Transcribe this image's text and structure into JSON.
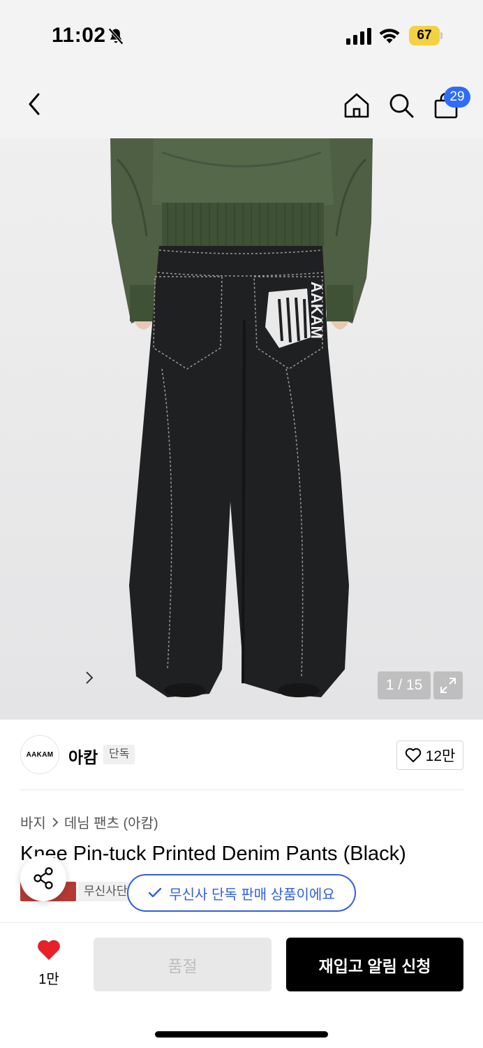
{
  "status_bar": {
    "time": "11:02",
    "battery": "67"
  },
  "header": {
    "cart_count": "29"
  },
  "gallery": {
    "counter": "1 / 15"
  },
  "brand": {
    "logo_text": "AAKAM",
    "name": "아캄",
    "tag": "단독",
    "likes": "12만"
  },
  "product": {
    "breadcrumb": [
      "바지",
      "데님 팬츠 (아캄)"
    ],
    "title": "Knee Pin-tuck Printed Denim Pants (Black)",
    "tag_red": "상",
    "tag_grey": "무신사단독"
  },
  "toast": {
    "text": "무신사 단독 판매 상품이에요"
  },
  "bottom_bar": {
    "like_count": "1만",
    "soldout_label": "품절",
    "restock_label": "재입고 알림 신청"
  },
  "colors": {
    "accent": "#2f5fe0",
    "badge": "#2f6df6",
    "like_red": "#e8202a",
    "tag_red": "#b53a33"
  },
  "icons": [
    "bell-slash-icon",
    "signal-icon",
    "wifi-icon",
    "back-icon",
    "home-icon",
    "search-icon",
    "bag-icon",
    "expand-icon",
    "heart-outline-icon",
    "chevron-right-icon",
    "share-icon",
    "check-icon",
    "heart-filled-icon"
  ]
}
